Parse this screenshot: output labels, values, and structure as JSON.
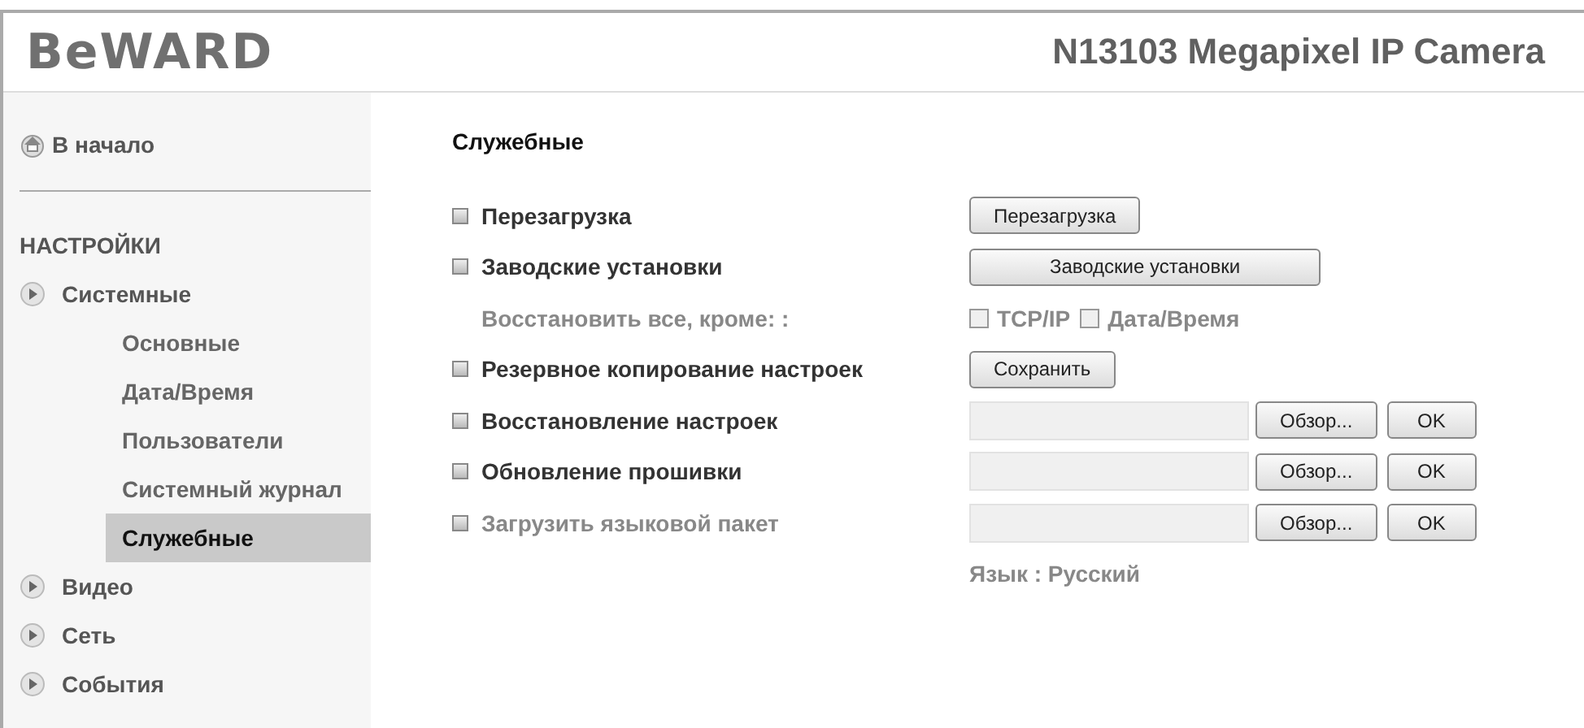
{
  "header": {
    "logo": "BeWARD",
    "title": "N13103 Megapixel IP Camera"
  },
  "sidebar": {
    "home": "В начало",
    "section": "НАСТРОЙКИ",
    "groups": [
      {
        "label": "Системные",
        "children": [
          {
            "label": "Основные",
            "selected": false
          },
          {
            "label": "Дата/Время",
            "selected": false
          },
          {
            "label": "Пользователи",
            "selected": false
          },
          {
            "label": "Системный журнал",
            "selected": false
          },
          {
            "label": "Служебные",
            "selected": true
          }
        ]
      },
      {
        "label": "Видео"
      },
      {
        "label": "Сеть"
      },
      {
        "label": "События"
      }
    ]
  },
  "page": {
    "title": "Служебные",
    "rows": [
      {
        "kind": "button",
        "label": "Перезагрузка",
        "disabled": false,
        "button": "Перезагрузка"
      },
      {
        "kind": "button",
        "label": "Заводские установки",
        "disabled": false,
        "button": "Заводские установки"
      },
      {
        "kind": "checkboxes",
        "label": "Восстановить все, кроме: :",
        "disabled": true,
        "options": [
          {
            "label": "TCP/IP",
            "checked": false
          },
          {
            "label": "Дата/Время",
            "checked": false
          }
        ]
      },
      {
        "kind": "button",
        "label": "Резервное копирование настроек",
        "disabled": false,
        "button": "Сохранить"
      },
      {
        "kind": "file",
        "label": "Восстановление настроек",
        "disabled": false,
        "browse": "Обзор...",
        "ok": "OK"
      },
      {
        "kind": "file",
        "label": "Обновление прошивки",
        "disabled": false,
        "browse": "Обзор...",
        "ok": "OK"
      },
      {
        "kind": "file",
        "label": "Загрузить языковой пакет",
        "disabled": true,
        "browse": "Обзор...",
        "ok": "OK"
      },
      {
        "kind": "note",
        "text": "Язык : Русский"
      }
    ]
  }
}
